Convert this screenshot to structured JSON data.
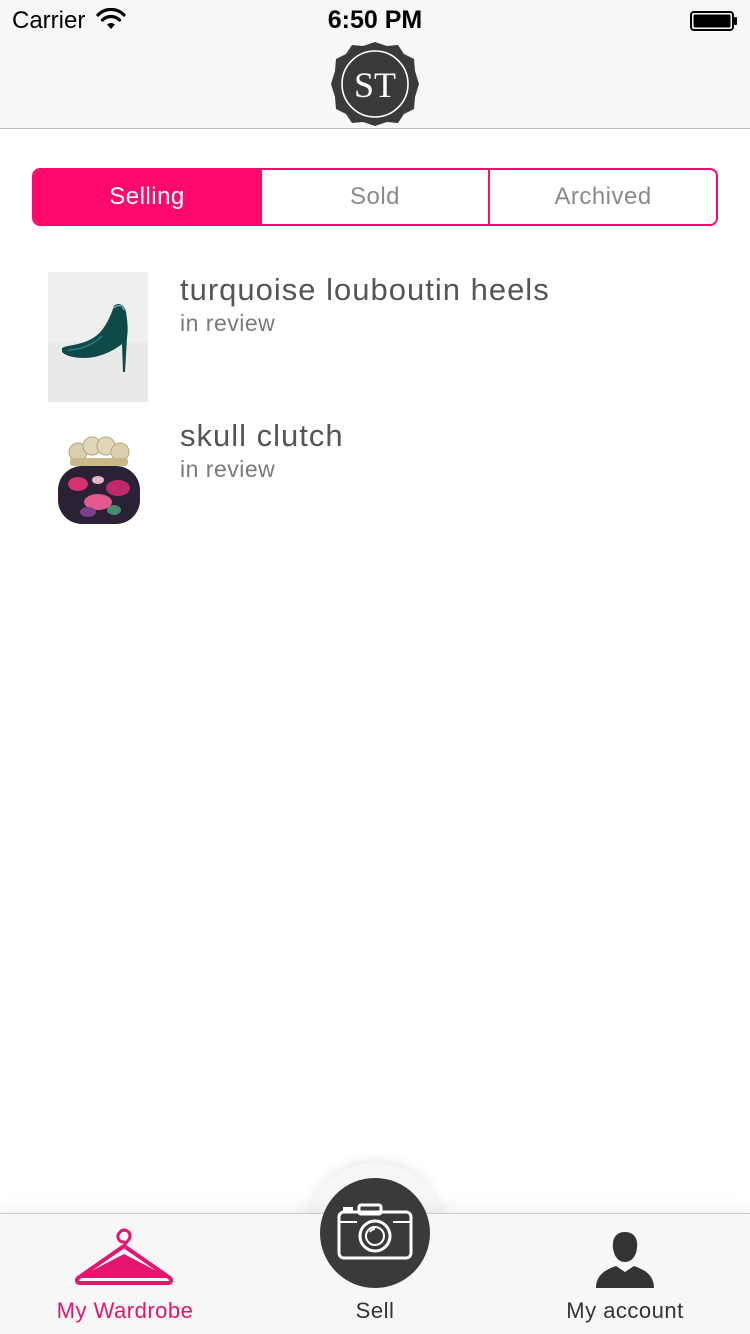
{
  "status_bar": {
    "carrier": "Carrier",
    "time": "6:50 PM"
  },
  "header": {
    "logo_text": "ST"
  },
  "segments": [
    {
      "label": "Selling",
      "active": true
    },
    {
      "label": "Sold",
      "active": false
    },
    {
      "label": "Archived",
      "active": false
    }
  ],
  "listings": [
    {
      "title": "turquoise louboutin heels",
      "status": "in review",
      "image": "teal-stiletto-photo"
    },
    {
      "title": "skull clutch",
      "status": "in review",
      "image": "skull-clutch-photo"
    }
  ],
  "tabs": [
    {
      "label": "My Wardrobe",
      "icon": "hanger-icon",
      "active": true
    },
    {
      "label": "Sell",
      "icon": "camera-icon",
      "active": false
    },
    {
      "label": "My account",
      "icon": "person-icon",
      "active": false
    }
  ],
  "colors": {
    "accent": "#ff0a6c",
    "tab_active": "#e3156f",
    "dark": "#3a3a3a"
  }
}
